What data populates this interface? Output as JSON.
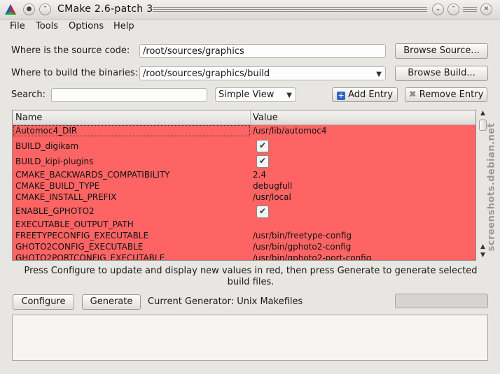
{
  "window": {
    "title": "CMake 2.6-patch 3"
  },
  "menu": {
    "file": "File",
    "tools": "Tools",
    "options": "Options",
    "help": "Help"
  },
  "source": {
    "label": "Where is the source code:",
    "value": "/root/sources/graphics",
    "browse": "Browse Source..."
  },
  "build": {
    "label": "Where to build the binaries:",
    "value": "/root/sources/graphics/build",
    "browse": "Browse Build..."
  },
  "search": {
    "label": "Search:",
    "value": "",
    "placeholder": ""
  },
  "view": {
    "selected": "Simple View"
  },
  "entries": {
    "add": "Add Entry",
    "remove": "Remove Entry"
  },
  "table": {
    "columns": [
      "Name",
      "Value"
    ],
    "row_color": "#ff6464",
    "rows": [
      {
        "name": "Automoc4_DIR",
        "value": "/usr/lib/automoc4",
        "checkbox": false
      },
      {
        "name": "BUILD_digikam",
        "value": "",
        "checkbox": true,
        "checked": true
      },
      {
        "name": "BUILD_kipi-plugins",
        "value": "",
        "checkbox": true,
        "checked": true
      },
      {
        "name": "CMAKE_BACKWARDS_COMPATIBILITY",
        "value": "2.4",
        "checkbox": false
      },
      {
        "name": "CMAKE_BUILD_TYPE",
        "value": "debugfull",
        "checkbox": false
      },
      {
        "name": "CMAKE_INSTALL_PREFIX",
        "value": "/usr/local",
        "checkbox": false
      },
      {
        "name": "ENABLE_GPHOTO2",
        "value": "",
        "checkbox": true,
        "checked": true
      },
      {
        "name": "EXECUTABLE_OUTPUT_PATH",
        "value": "",
        "checkbox": false
      },
      {
        "name": "FREETYPECONFIG_EXECUTABLE",
        "value": "/usr/bin/freetype-config",
        "checkbox": false
      },
      {
        "name": "GHOTO2CONFIG_EXECUTABLE",
        "value": "/usr/bin/gphoto2-config",
        "checkbox": false
      },
      {
        "name": "GHOTO2PORTCONFIG_EXECUTABLE",
        "value": "/usr/bin/gphoto2-port-config",
        "checkbox": false
      }
    ]
  },
  "hint": "Press Configure to update and display new values in red, then press Generate to generate selected build files.",
  "actions": {
    "configure": "Configure",
    "generate": "Generate",
    "generator": "Current Generator: Unix Makefiles"
  },
  "watermark": "screenshots.debian.net",
  "icons": {
    "app": "cmake-triangle-icon",
    "add": "plus-icon",
    "remove": "x-icon"
  }
}
